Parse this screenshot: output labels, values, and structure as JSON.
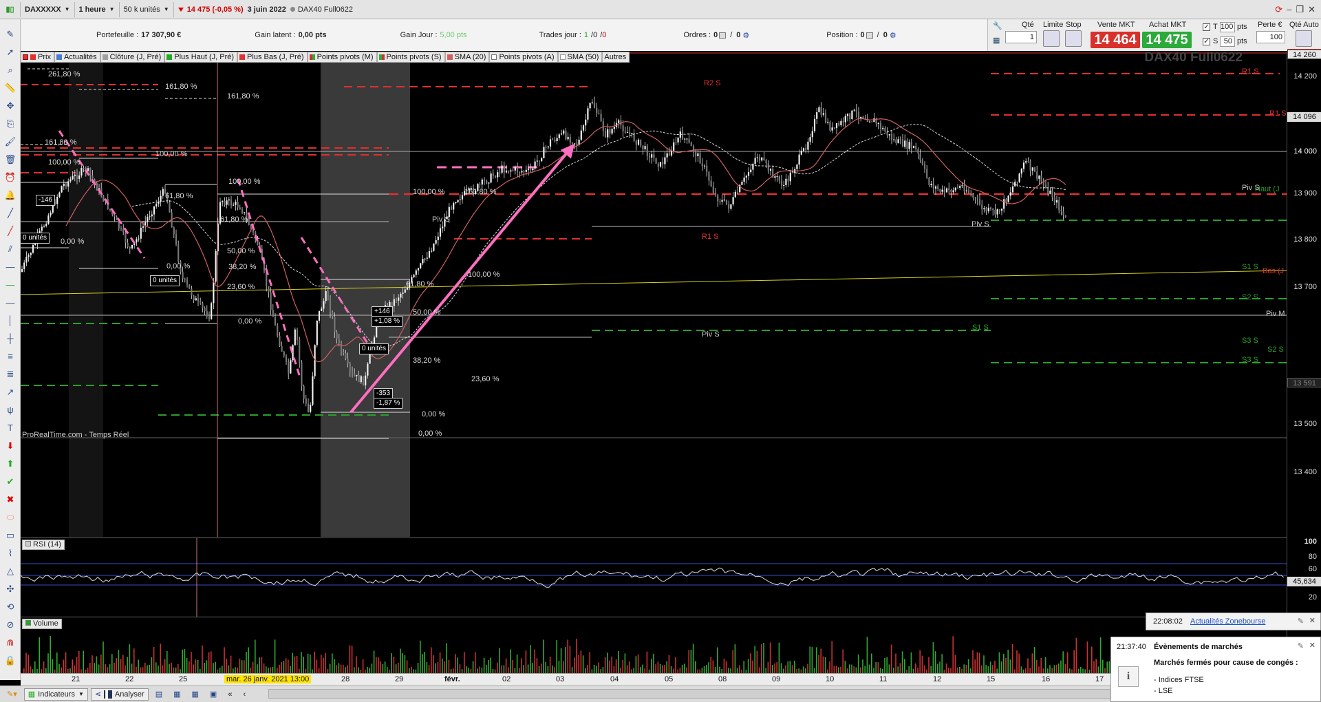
{
  "topbar": {
    "instrument": "DAXXXXX",
    "timeframe": "1 heure",
    "units": "50 k unités",
    "change": "14 475 (-0,05 %)",
    "date": "3 juin 2022",
    "contract": "DAX40 Full0622"
  },
  "info": {
    "portfolio_label": "Portefeuille :",
    "portfolio_value": "17 307,90 €",
    "latent_label": "Gain latent :",
    "latent_value": "0,00 pts",
    "day_label": "Gain Jour :",
    "day_value": "5,00 pts",
    "trades_label": "Trades jour :",
    "trades_a": "1",
    "trades_b": "0",
    "trades_c": "0",
    "orders_label": "Ordres :",
    "orders_a": "0",
    "orders_b": "0",
    "position_label": "Position :",
    "position_a": "0",
    "position_b": "0"
  },
  "trade": {
    "qty_label": "Qté",
    "qty_value": "1",
    "limit_label": "Limite",
    "stop_label": "Stop",
    "sell_label": "Vente MKT",
    "sell_price": "14 464",
    "buy_label": "Achat MKT",
    "buy_price": "14 475",
    "t_label": "T",
    "t_value": "100",
    "s_label": "S",
    "s_value": "50",
    "pts": "pts",
    "loss_label": "Perte €",
    "loss_value": "100",
    "auto_label": "Qté Auto"
  },
  "legend": [
    {
      "label": "Prix",
      "color": "#b0b0b0"
    },
    {
      "label": "Actualités",
      "color": "#4a7bd0"
    },
    {
      "label": "Clôture (J, Pré)",
      "color": "#a0a0a0"
    },
    {
      "label": "Plus Haut (J, Pré)",
      "color": "#22aa22"
    },
    {
      "label": "Plus Bas (J, Pré)",
      "color": "#dd3333"
    },
    {
      "label": "Points pivots (M)",
      "color": "#cc3333"
    },
    {
      "label": "Points pivots (S)",
      "color": "#33aa33"
    },
    {
      "label": "SMA (20)",
      "color": "#d06060"
    },
    {
      "label": "Points pivots (A)",
      "color": "#ffffff"
    },
    {
      "label": "SMA (50)",
      "color": "#ffffff"
    },
    {
      "label": "Autres",
      "color": ""
    }
  ],
  "chart": {
    "watermark": "DAX40 Full0622",
    "source": "ProRealTime.com - Temps Réel",
    "rsi_label": "RSI (14)",
    "rsi_value": "45,634",
    "volume_label": "Volume",
    "axis_ticks": [
      "14 200",
      "14 100",
      "14 000",
      "13 900",
      "13 800",
      "13 700",
      "13 600",
      "13 500",
      "13 400"
    ],
    "axis_tag_top": "14 260",
    "axis_tag_mid": "14 096",
    "axis_tag_low": "13 591",
    "rsi_ticks": [
      "100",
      "80",
      "60",
      "40",
      "20"
    ],
    "dates": [
      "21",
      "22",
      "25",
      "mar. 26 janv. 2021 13:00",
      "28",
      "29",
      "févr.",
      "02",
      "03",
      "04",
      "05",
      "08",
      "09",
      "10",
      "11",
      "12",
      "15",
      "16",
      "17"
    ],
    "fib_labels": [
      "261,80 %",
      "161,80 %",
      "161,80 %",
      "161,80 %",
      "100,00 %",
      "100,00 %",
      "100,00 %",
      "100,00 %",
      "161,80 %",
      "100,00 %",
      "61,80 %",
      "61,80 %",
      "61,80 %",
      "50,00 %",
      "50,00 %",
      "38,20 %",
      "38,20 %",
      "23,60 %",
      "23,60 %",
      "0,00 %",
      "0,00 %",
      "0,00 %",
      "0,00 %",
      "0,00 %",
      "261,80 %"
    ],
    "pivot_labels": [
      "R2 S",
      "R1 S",
      "R1 S",
      "R1 S",
      "Piv S",
      "Piv S",
      "Piv S",
      "Piv S",
      "S1 S",
      "S1 S",
      "S2 S",
      "S2 S",
      "S3 S",
      "S3 S",
      "Piv M",
      "Haut (J",
      "Bas (J"
    ],
    "boxes": [
      "-146",
      "0 unités",
      "0 unités",
      "0 unités",
      "+146",
      "+1,08 %",
      "-353",
      "-1,87 %"
    ]
  },
  "notifications": [
    {
      "time": "22:08:02",
      "title": "Actualités Zonebourse"
    },
    {
      "time": "21:37:40",
      "title": "Évènements de marchés",
      "text": "Marchés fermés pour cause de congés :",
      "items": [
        "- Indices FTSE",
        "- LSE"
      ]
    }
  ],
  "bottom": {
    "indicators": "Indicateurs",
    "analyze": "Analyser"
  }
}
